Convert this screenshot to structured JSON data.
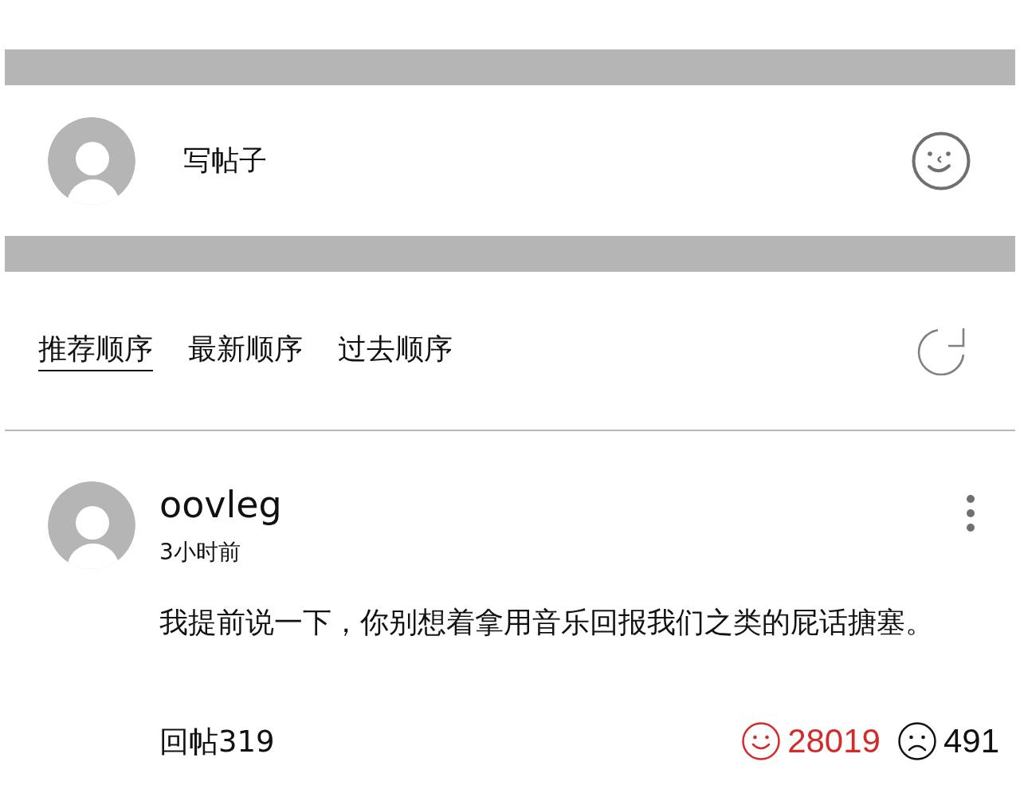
{
  "composer": {
    "label": "写帖子"
  },
  "sort_tabs": [
    {
      "label": "推荐顺序",
      "selected": true
    },
    {
      "label": "最新顺序",
      "selected": false
    },
    {
      "label": "过去顺序",
      "selected": false
    }
  ],
  "comments": [
    {
      "username": "oovleg",
      "time": "3小时前",
      "body": "我提前说一下，你别想着拿用音乐回报我们之类的屁话搪塞。",
      "replies": "回帖319",
      "reactions": [
        {
          "kind": "like",
          "count": "28019",
          "selected": true
        },
        {
          "kind": "dislike",
          "count": "491",
          "selected": false
        }
      ]
    }
  ]
}
